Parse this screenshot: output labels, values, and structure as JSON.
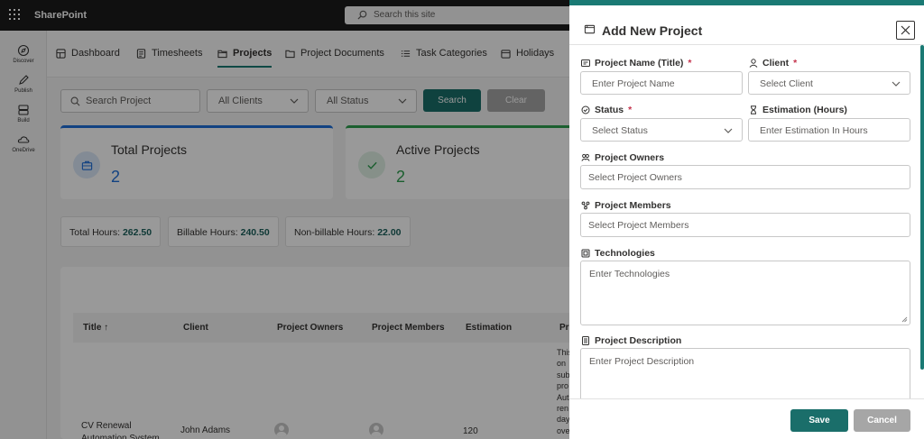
{
  "suitebar": {
    "brand": "SharePoint",
    "search_placeholder": "Search this site"
  },
  "rail": [
    {
      "label": "Discover",
      "icon": "compass-icon"
    },
    {
      "label": "Publish",
      "icon": "pen-icon"
    },
    {
      "label": "Build",
      "icon": "build-icon"
    },
    {
      "label": "OneDrive",
      "icon": "cloud-icon"
    }
  ],
  "nav": {
    "tabs": [
      {
        "label": "Dashboard",
        "icon": "dashboard-icon"
      },
      {
        "label": "Timesheets",
        "icon": "timesheet-icon"
      },
      {
        "label": "Projects",
        "icon": "folder-icon",
        "active": true
      },
      {
        "label": "Project Documents",
        "icon": "folder-outline-icon"
      },
      {
        "label": "Task Categories",
        "icon": "list-icon"
      },
      {
        "label": "Holidays",
        "icon": "calendar-icon"
      }
    ]
  },
  "filters": {
    "search_placeholder": "Search Project",
    "clients_value": "All Clients",
    "status_value": "All Status",
    "search_label": "Search",
    "clear_label": "Clear"
  },
  "cards": [
    {
      "title": "Total Projects",
      "value": "2",
      "icon": "briefcase-icon"
    },
    {
      "title": "Active Projects",
      "value": "2",
      "icon": "check-icon"
    }
  ],
  "stats": [
    {
      "label": "Total Hours:",
      "value": "262.50"
    },
    {
      "label": "Billable Hours:",
      "value": "240.50"
    },
    {
      "label": "Non-billable Hours:",
      "value": "22.00"
    }
  ],
  "table": {
    "headers": [
      "Title ↑",
      "Client",
      "Project Owners",
      "Project Members",
      "Estimation",
      "Pr"
    ],
    "row": {
      "title": "CV Renewal Automation System",
      "client": "John Adams",
      "estimation": "120",
      "description_lines": [
        "This",
        "on",
        "sub",
        "pro",
        "Aut",
        "ren",
        "day",
        "ove"
      ]
    }
  },
  "panel": {
    "title": "Add New Project",
    "fields": {
      "project_name": {
        "label": "Project Name (Title)",
        "required": "*",
        "placeholder": "Enter Project Name"
      },
      "client": {
        "label": "Client",
        "required": "*",
        "placeholder": "Select Client"
      },
      "status": {
        "label": "Status",
        "required": "*",
        "placeholder": "Select Status"
      },
      "estimation": {
        "label": "Estimation (Hours)",
        "placeholder": "Enter Estimation In Hours"
      },
      "owners": {
        "label": "Project Owners",
        "placeholder": "Select Project Owners"
      },
      "members": {
        "label": "Project Members",
        "placeholder": "Select Project Members"
      },
      "technologies": {
        "label": "Technologies",
        "placeholder": "Enter Technologies"
      },
      "description": {
        "label": "Project Description",
        "placeholder": "Enter Project Description"
      }
    },
    "save_label": "Save",
    "cancel_label": "Cancel"
  },
  "colors": {
    "accent": "#1a7a74",
    "primary_button": "#1a6e6a",
    "blue": "#1e6fd9",
    "green": "#2e9e4f",
    "required": "#c4314b"
  }
}
